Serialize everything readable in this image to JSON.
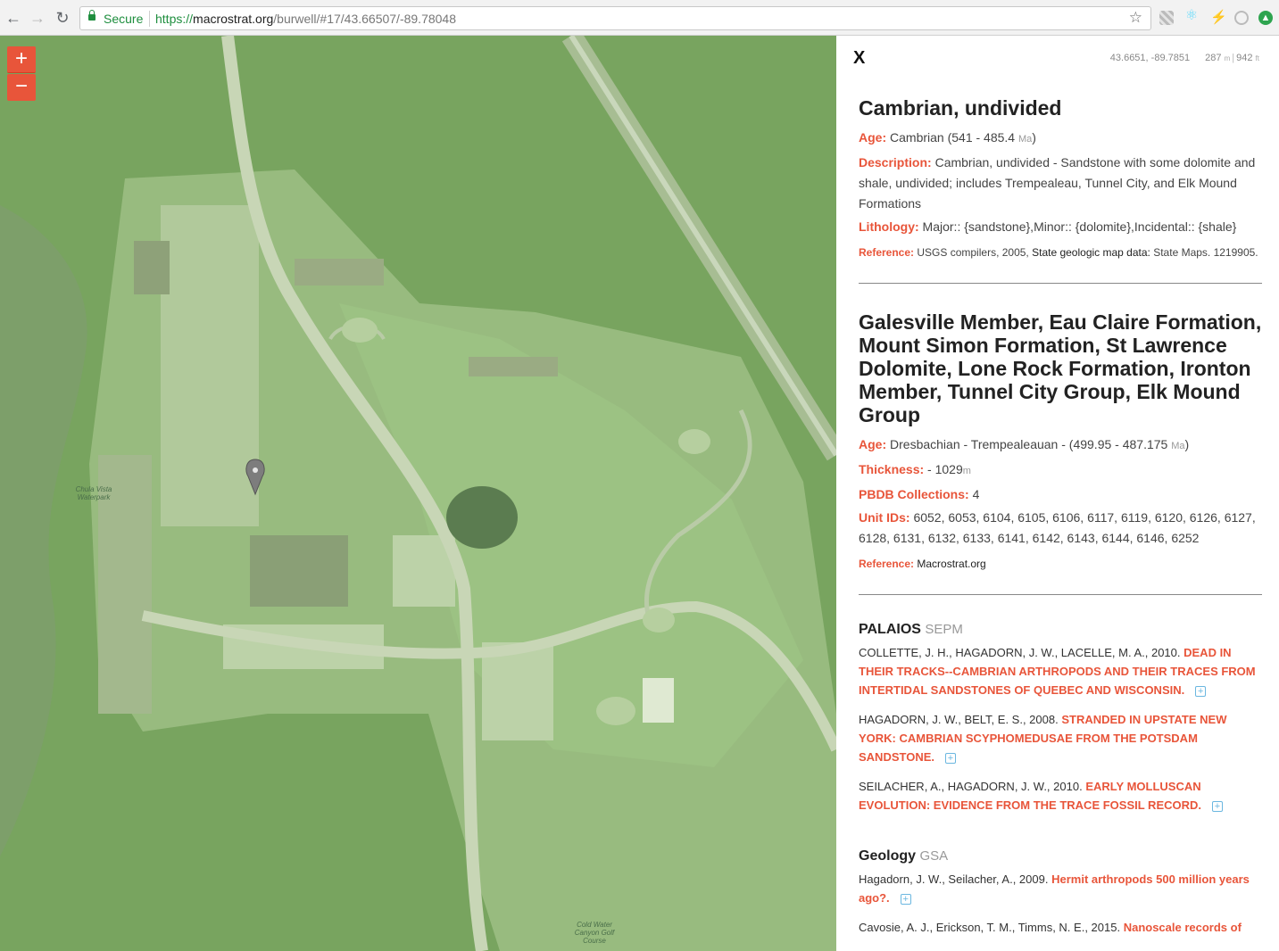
{
  "browser": {
    "back": "←",
    "forward": "→",
    "reload": "↻",
    "secure_label": "Secure",
    "url_scheme": "https://",
    "url_host": "macrostrat.org",
    "url_path": "/burwell/#17/43.66507/-89.78048",
    "star": "☆"
  },
  "map": {
    "zoom_in": "+",
    "zoom_out": "−",
    "labels": {
      "golf_course": "Cold Water Canyon Golf Course",
      "waterpark": "Chula Vista Waterpark"
    }
  },
  "panel": {
    "close": "X",
    "lat": "43.6651",
    "lng": "-89.7851",
    "elev_m": "287",
    "elev_m_unit": "m",
    "elev_ft": "942",
    "elev_ft_unit": "ft",
    "unit1": {
      "name": "Cambrian, undivided",
      "age_label": "Age:",
      "age_value": "Cambrian (541 - 485.4",
      "age_unit": "Ma",
      "age_close": ")",
      "desc_label": "Description:",
      "desc_value": "Cambrian, undivided - Sandstone with some dolomite and shale, undivided; includes Trempealeau, Tunnel City, and Elk Mound Formations",
      "lith_label": "Lithology:",
      "lith_value": "Major:: {sandstone},Minor:: {dolomite},Incidental:: {shale}",
      "ref_label": "Reference:",
      "ref_authors": "USGS compilers, 2005,",
      "ref_title": "State geologic map data:",
      "ref_source": "State Maps. 1219905."
    },
    "unit2": {
      "name": "Galesville Member, Eau Claire Formation, Mount Simon Formation, St Lawrence Dolomite, Lone Rock Formation, Ironton Member, Tunnel City Group, Elk Mound Group",
      "age_label": "Age:",
      "age_value": "Dresbachian - Trempealeauan - (499.95 - 487.175",
      "age_unit": "Ma",
      "age_close": ")",
      "thick_label": "Thickness:",
      "thick_value": "- 1029",
      "thick_unit": "m",
      "pbdb_label": "PBDB Collections:",
      "pbdb_value": "4",
      "ids_label": "Unit IDs:",
      "ids_value": "6052, 6053, 6104, 6105, 6106, 6117, 6119, 6120, 6126, 6127, 6128, 6131, 6132, 6133, 6141, 6142, 6143, 6144, 6146, 6252",
      "ref_label": "Reference:",
      "ref_value": "Macrostrat.org"
    },
    "journals": [
      {
        "name": "PALAIOS",
        "publisher": "SEPM",
        "articles": [
          {
            "authors": "COLLETTE, J. H., HAGADORN, J. W., LACELLE, M. A., 2010.",
            "title": "DEAD IN THEIR TRACKS--CAMBRIAN ARTHROPODS AND THEIR TRACES FROM INTERTIDAL SANDSTONES OF QUEBEC AND WISCONSIN."
          },
          {
            "authors": "HAGADORN, J. W., BELT, E. S., 2008.",
            "title": "STRANDED IN UPSTATE NEW YORK: CAMBRIAN SCYPHOMEDUSAE FROM THE POTSDAM SANDSTONE."
          },
          {
            "authors": "SEILACHER, A., HAGADORN, J. W., 2010.",
            "title": "EARLY MOLLUSCAN EVOLUTION: EVIDENCE FROM THE TRACE FOSSIL RECORD."
          }
        ]
      },
      {
        "name": "Geology",
        "publisher": "GSA",
        "articles": [
          {
            "authors": "Hagadorn, J. W., Seilacher, A., 2009.",
            "title": "Hermit arthropods 500 million years ago?."
          },
          {
            "authors": "Cavosie, A. J., Erickson, T. M., Timms, N. E., 2015.",
            "title": "Nanoscale records of"
          }
        ]
      }
    ],
    "plus_icon": "+"
  }
}
